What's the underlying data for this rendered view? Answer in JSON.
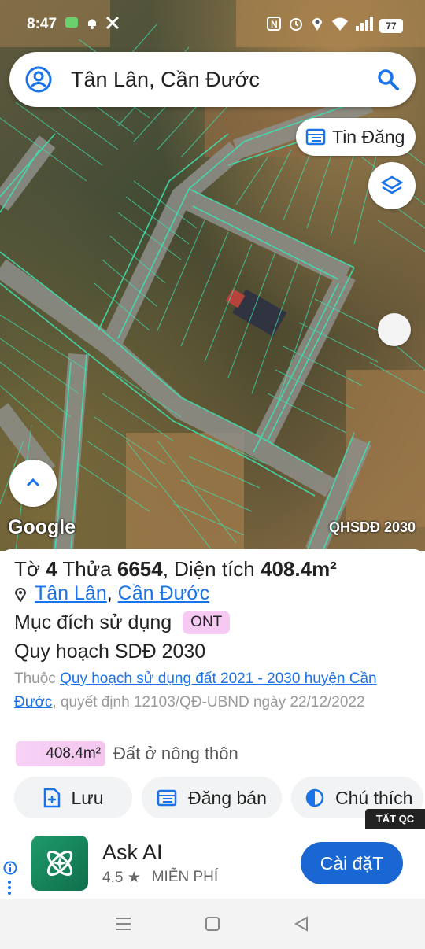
{
  "status": {
    "time": "8:47",
    "battery": "77"
  },
  "search": {
    "text": "Tân Lân, Cần Đước"
  },
  "map": {
    "tin_dang_label": "Tin Đăng",
    "google_logo": "Google",
    "layer_label": "QHSDĐ 2030"
  },
  "parcel": {
    "to_label": "Tờ",
    "to_value": "4",
    "thua_label": "Thửa",
    "thua_value": "6654",
    "dien_tich_label": ", Diện tích",
    "dien_tich_value": "408.4m²",
    "commune": "Tân Lân",
    "separator": ",",
    "district": "Cần Đước",
    "purpose_label": "Mục đích sử dụng",
    "purpose_code": "ONT",
    "plan_title": "Quy hoạch SDĐ 2030",
    "desc_prefix": "Thuộc",
    "desc_link": "Quy hoạch sử dụng đất 2021 - 2030 huyện Cần Đước",
    "desc_suffix": ", quyết định 12103/QĐ-UBND ngày 22/12/2022",
    "area_chip": "408.4m²",
    "area_type": "Đất ở nông thôn"
  },
  "actions": {
    "save": "Lưu",
    "post_sale": "Đăng bán",
    "legend": "Chú thích"
  },
  "ad": {
    "tag": "TẤT QC",
    "title": "Ask AI",
    "rating": "4.5 ★",
    "price": "MIỄN PHÍ",
    "install": "Cài đặT"
  },
  "colors": {
    "accent": "#1a73e8",
    "parcel_line": "#3fe0b0",
    "badge": "#f6c9f2",
    "install": "#1a66d2"
  }
}
